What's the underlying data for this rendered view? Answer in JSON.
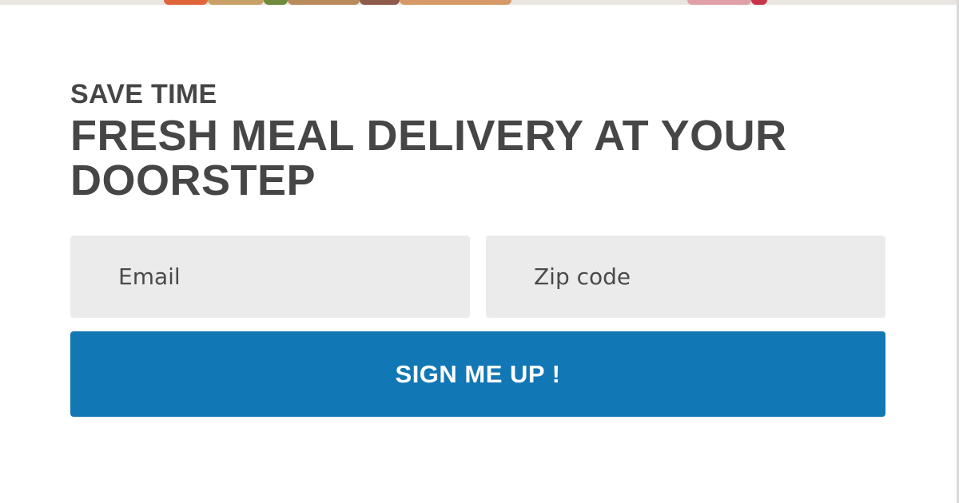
{
  "hero": {
    "eyebrow": "SAVE TIME",
    "headline": "FRESH MEAL DELIVERY AT YOUR DOORSTEP"
  },
  "form": {
    "email_placeholder": "Email",
    "zip_placeholder": "Zip code",
    "submit_label": "SIGN ME UP !"
  },
  "colors": {
    "text": "#464646",
    "field_background": "#ebebeb",
    "button_background": "#1277b5",
    "button_text": "#ffffff"
  }
}
